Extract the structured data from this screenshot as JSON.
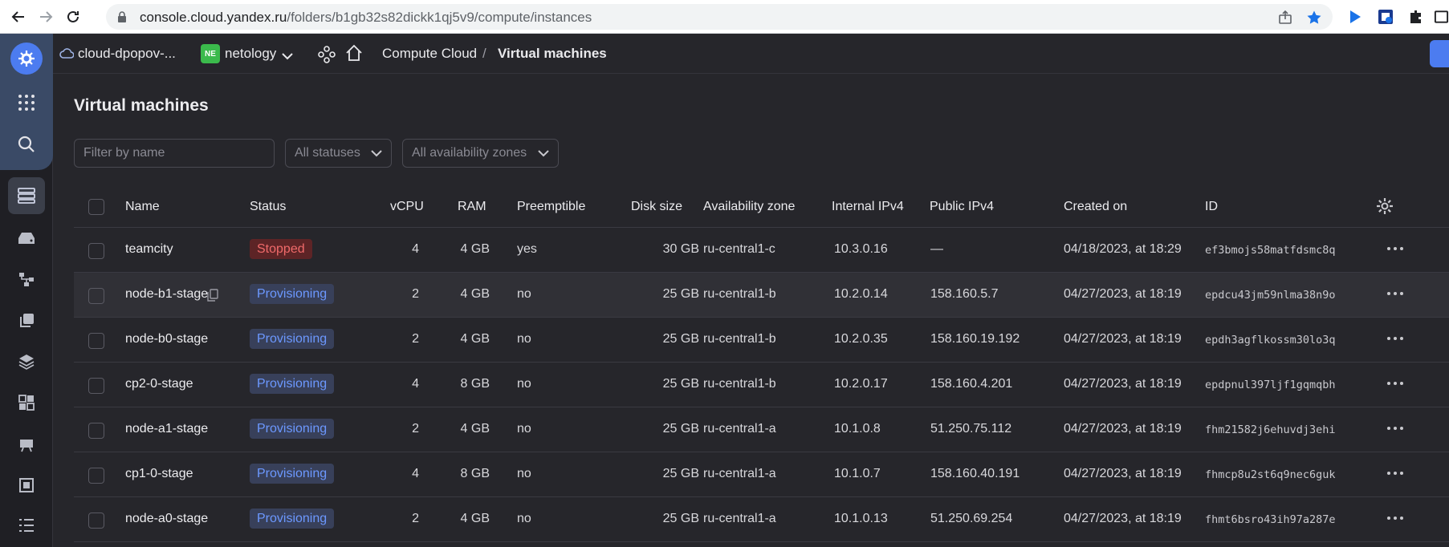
{
  "browser": {
    "url_host": "console.cloud.yandex.ru",
    "url_path": "/folders/b1gb32s82dickk1qj5v9/compute/instances"
  },
  "header": {
    "cloud_name": "cloud-dpopov-...",
    "folder_badge": "NE",
    "folder_name": "netology",
    "breadcrumb_service": "Compute Cloud",
    "breadcrumb_sep": "/",
    "breadcrumb_page": "Virtual machines"
  },
  "page": {
    "title": "Virtual machines"
  },
  "filters": {
    "name_placeholder": "Filter by name",
    "status_select": "All statuses",
    "zone_select": "All availability zones"
  },
  "table": {
    "columns": {
      "name": "Name",
      "status": "Status",
      "vcpu": "vCPU",
      "ram": "RAM",
      "preemptible": "Preemptible",
      "disk": "Disk size",
      "zone": "Availability zone",
      "internal_ip": "Internal IPv4",
      "public_ip": "Public IPv4",
      "created": "Created on",
      "id": "ID"
    },
    "rows": [
      {
        "name": "teamcity",
        "status": "Stopped",
        "status_kind": "stopped",
        "vcpu": "4",
        "ram": "4 GB",
        "preemptible": "yes",
        "disk": "30 GB",
        "zone": "ru-central1-c",
        "internal_ip": "10.3.0.16",
        "public_ip": "—",
        "created": "04/18/2023, at 18:29",
        "id": "ef3bmojs58matfdsmc8q"
      },
      {
        "name": "node-b1-stage",
        "status": "Provisioning",
        "status_kind": "prov",
        "vcpu": "2",
        "ram": "4 GB",
        "preemptible": "no",
        "disk": "25 GB",
        "zone": "ru-central1-b",
        "internal_ip": "10.2.0.14",
        "public_ip": "158.160.5.7",
        "created": "04/27/2023, at 18:19",
        "id": "epdcu43jm59nlma38n9o"
      },
      {
        "name": "node-b0-stage",
        "status": "Provisioning",
        "status_kind": "prov",
        "vcpu": "2",
        "ram": "4 GB",
        "preemptible": "no",
        "disk": "25 GB",
        "zone": "ru-central1-b",
        "internal_ip": "10.2.0.35",
        "public_ip": "158.160.19.192",
        "created": "04/27/2023, at 18:19",
        "id": "epdh3agflkossm30lo3q"
      },
      {
        "name": "cp2-0-stage",
        "status": "Provisioning",
        "status_kind": "prov",
        "vcpu": "4",
        "ram": "8 GB",
        "preemptible": "no",
        "disk": "25 GB",
        "zone": "ru-central1-b",
        "internal_ip": "10.2.0.17",
        "public_ip": "158.160.4.201",
        "created": "04/27/2023, at 18:19",
        "id": "epdpnul397ljf1gqmqbh"
      },
      {
        "name": "node-a1-stage",
        "status": "Provisioning",
        "status_kind": "prov",
        "vcpu": "2",
        "ram": "4 GB",
        "preemptible": "no",
        "disk": "25 GB",
        "zone": "ru-central1-a",
        "internal_ip": "10.1.0.8",
        "public_ip": "51.250.75.112",
        "created": "04/27/2023, at 18:19",
        "id": "fhm21582j6ehuvdj3ehi"
      },
      {
        "name": "cp1-0-stage",
        "status": "Provisioning",
        "status_kind": "prov",
        "vcpu": "4",
        "ram": "8 GB",
        "preemptible": "no",
        "disk": "25 GB",
        "zone": "ru-central1-a",
        "internal_ip": "10.1.0.7",
        "public_ip": "158.160.40.191",
        "created": "04/27/2023, at 18:19",
        "id": "fhmcp8u2st6q9nec6guk"
      },
      {
        "name": "node-a0-stage",
        "status": "Provisioning",
        "status_kind": "prov",
        "vcpu": "2",
        "ram": "4 GB",
        "preemptible": "no",
        "disk": "25 GB",
        "zone": "ru-central1-a",
        "internal_ip": "10.1.0.13",
        "public_ip": "51.250.69.254",
        "created": "04/27/2023, at 18:19",
        "id": "fhmt6bsro43ih97a287e"
      }
    ]
  },
  "colors": {
    "accent": "#4c7cf0",
    "stopped": "#f06a6a",
    "provisioning": "#6c98ff",
    "background": "#26262b"
  }
}
